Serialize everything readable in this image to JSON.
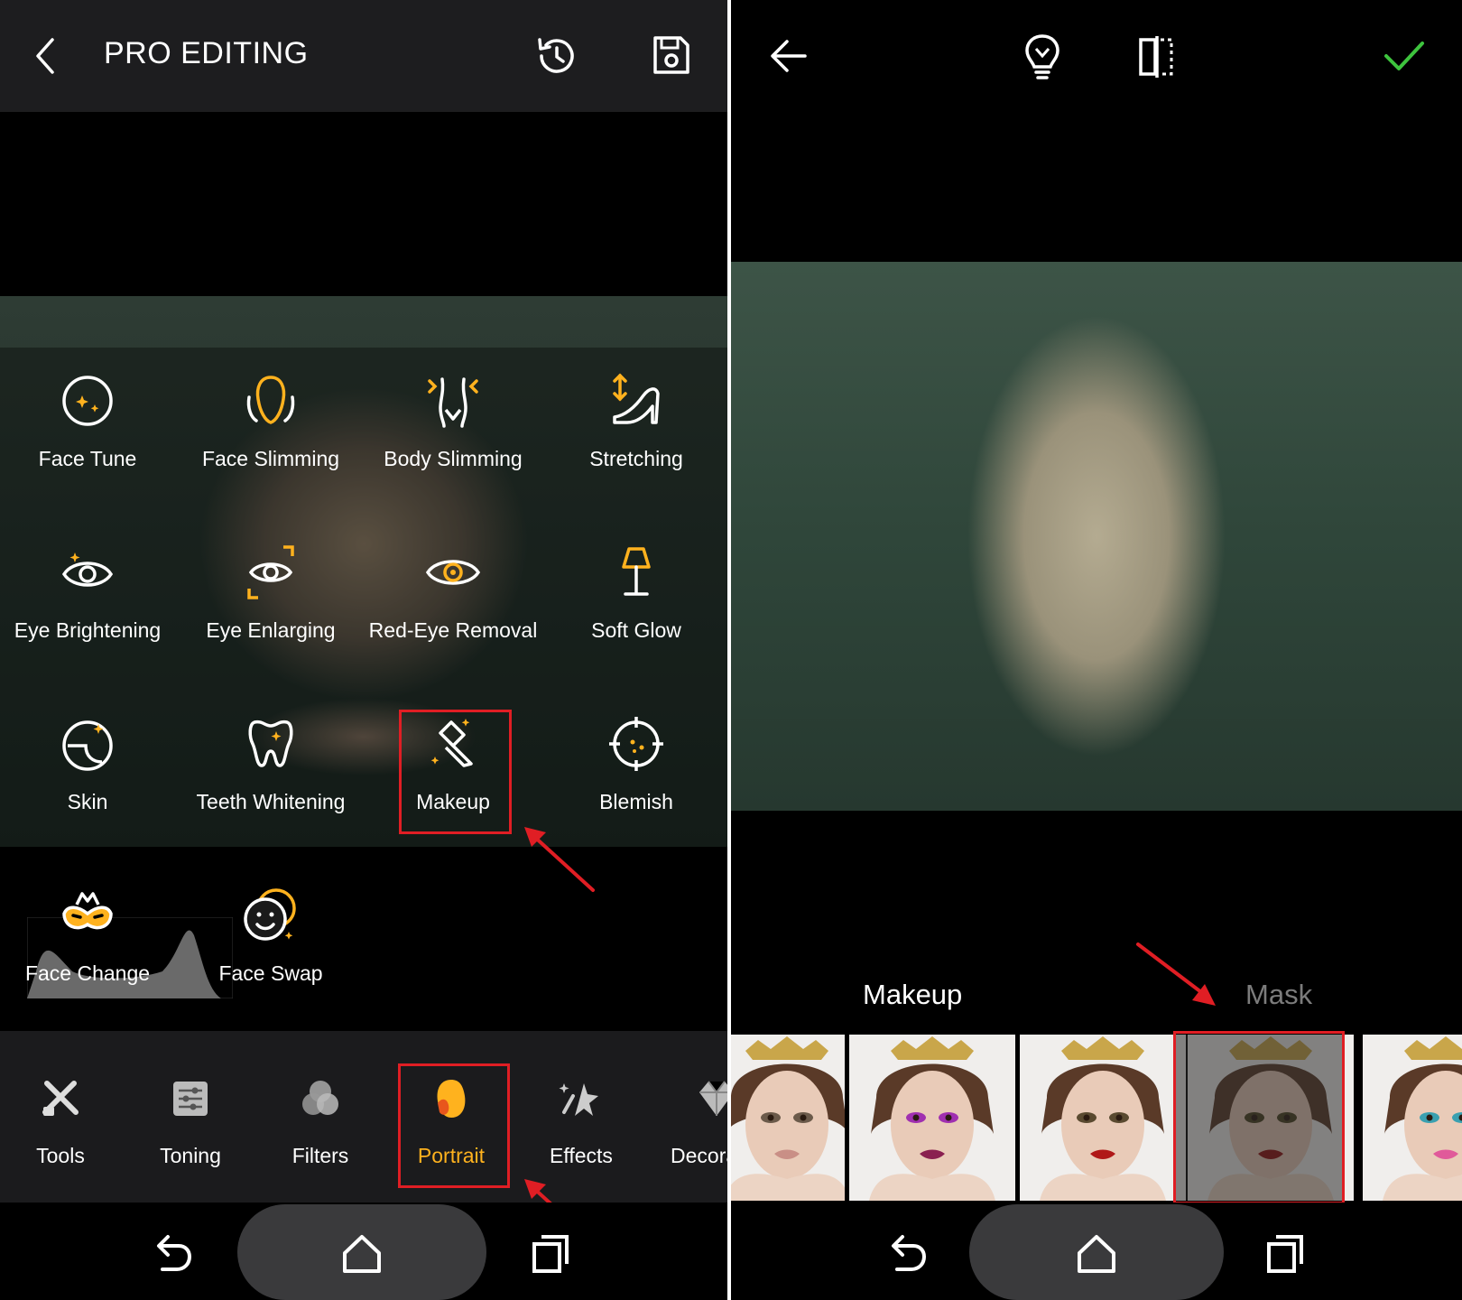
{
  "left_panel": {
    "header": {
      "title": "PRO EDITING",
      "back_icon": "chevron-left-icon",
      "history_icon": "history-icon",
      "save_icon": "save-icon"
    },
    "tools": [
      {
        "label": "Face Tune",
        "icon": "face-tune-icon"
      },
      {
        "label": "Face Slimming",
        "icon": "face-slimming-icon"
      },
      {
        "label": "Body Slimming",
        "icon": "body-slimming-icon"
      },
      {
        "label": "Stretching",
        "icon": "stretching-icon"
      },
      {
        "label": "Eye Brightening",
        "icon": "eye-brightening-icon"
      },
      {
        "label": "Eye Enlarging",
        "icon": "eye-enlarging-icon"
      },
      {
        "label": "Red-Eye Removal",
        "icon": "red-eye-removal-icon"
      },
      {
        "label": "Soft Glow",
        "icon": "soft-glow-icon"
      },
      {
        "label": "Skin",
        "icon": "skin-icon"
      },
      {
        "label": "Teeth Whitening",
        "icon": "teeth-whitening-icon"
      },
      {
        "label": "Makeup",
        "icon": "makeup-icon",
        "highlighted": true
      },
      {
        "label": "Blemish",
        "icon": "blemish-icon"
      },
      {
        "label": "Face Change",
        "icon": "face-change-icon"
      },
      {
        "label": "Face Swap",
        "icon": "face-swap-icon"
      }
    ],
    "tabs": [
      {
        "label": "Tools",
        "icon": "tools-icon"
      },
      {
        "label": "Toning",
        "icon": "toning-icon"
      },
      {
        "label": "Filters",
        "icon": "filters-icon"
      },
      {
        "label": "Portrait",
        "icon": "portrait-icon",
        "active": true
      },
      {
        "label": "Effects",
        "icon": "effects-icon"
      },
      {
        "label": "Decora",
        "icon": "decoration-icon"
      }
    ]
  },
  "right_panel": {
    "header": {
      "back_icon": "arrow-left-icon",
      "tip_icon": "lightbulb-icon",
      "compare_icon": "compare-icon",
      "confirm_icon": "checkmark-icon"
    },
    "categories": [
      {
        "label": "Makeup",
        "active": true
      },
      {
        "label": "Mask",
        "active": false
      }
    ],
    "presets": [
      {
        "name": "preset-1",
        "eye_color": "#6b5a4a",
        "lip_color": "#c98f86"
      },
      {
        "name": "preset-2",
        "eye_color": "#a030b0",
        "lip_color": "#8a2050"
      },
      {
        "name": "preset-3",
        "eye_color": "#5a4a30",
        "lip_color": "#b01818"
      },
      {
        "name": "preset-4",
        "eye_color": "#4a4020",
        "lip_color": "#901010",
        "highlighted": true
      },
      {
        "name": "preset-5",
        "eye_color": "#3aa0b0",
        "lip_color": "#e05a9a"
      }
    ]
  },
  "system_nav": {
    "back_icon": "system-back-icon",
    "home_icon": "system-home-icon",
    "recents_icon": "system-recents-icon"
  },
  "colors": {
    "accent": "#ffb21e",
    "highlight_box": "#e01e24",
    "confirm": "#3ec43e",
    "active_tab_text": "#ffb21e"
  }
}
